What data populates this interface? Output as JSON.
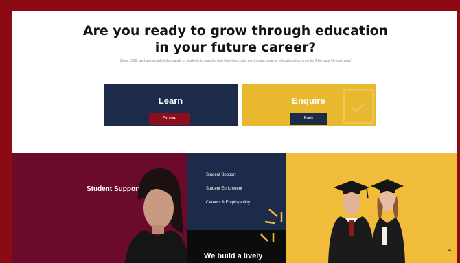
{
  "hero": {
    "title": "Are you ready to grow through education in your future career?",
    "subtitle": "Since 1836, we have enabled thousands of students to transforming their lives. Join our thriving, diverse educational community. After your life right now!"
  },
  "cards": {
    "learn": {
      "title": "Learn",
      "button_label": "Explore"
    },
    "enquire": {
      "title": "Enquire",
      "button_label": "Book"
    }
  },
  "support": {
    "heading": "Student Support",
    "links": [
      "Student Support",
      "Student Enrichment",
      "Careers & Employability"
    ],
    "tagline": "We build a lively"
  },
  "controls": {
    "scroll_top_icon": "chevron-up-icon"
  },
  "colors": {
    "frame": "#8b0a14",
    "navy": "#1c2b4a",
    "gold": "#e8b92e",
    "maroon": "#6b0a2b",
    "yellow": "#f0bc3a"
  }
}
